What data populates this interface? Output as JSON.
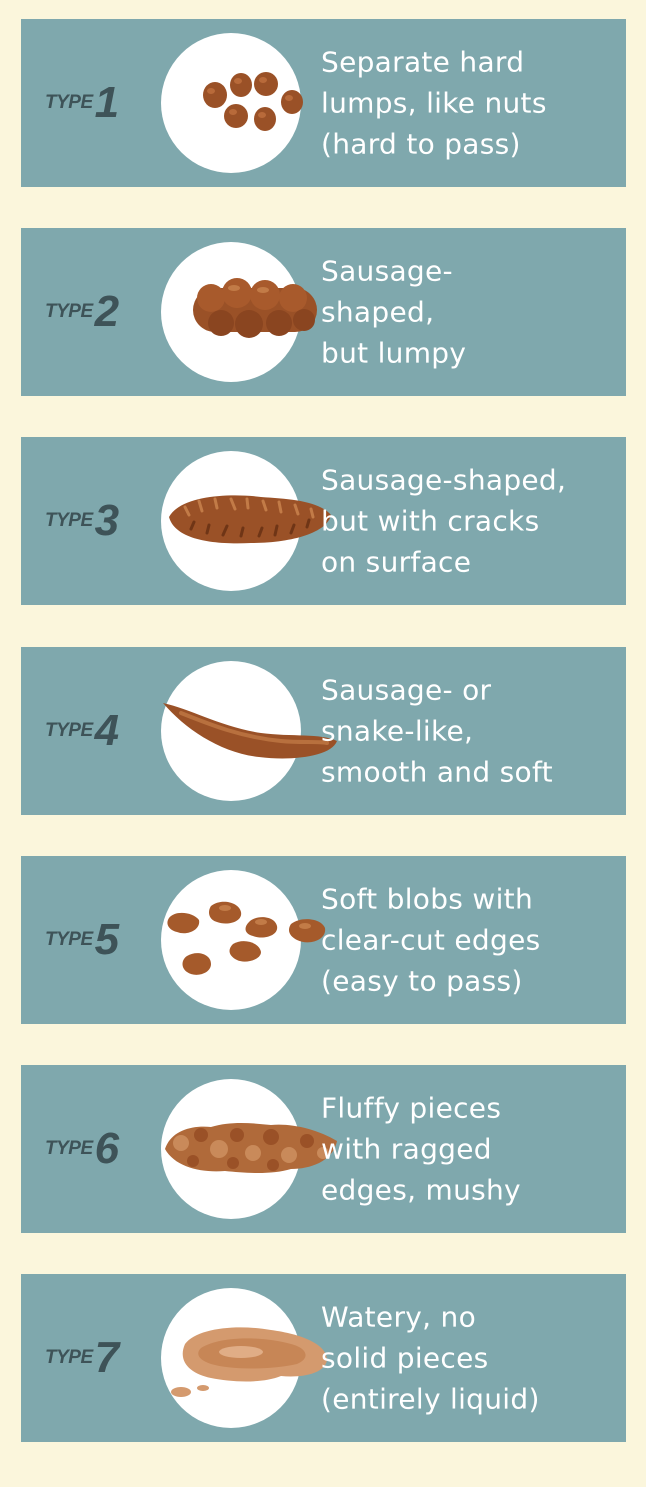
{
  "colors": {
    "background": "#fbf6dc",
    "card": "#7fa8ad",
    "label_text": "#3e5358",
    "description_text": "#ffffff",
    "circle": "#ffffff",
    "stool_dark": "#8a4a22",
    "stool_mid": "#a25a2c",
    "stool_light": "#c07a48",
    "stool_liquid": "#d49a6e"
  },
  "type_word": "TYPE",
  "types": [
    {
      "number": "1",
      "lines": [
        "Separate hard",
        "lumps, like nuts",
        "(hard to pass)"
      ],
      "icon": "hard-lumps-icon"
    },
    {
      "number": "2",
      "lines": [
        "Sausage-",
        "shaped,",
        "but lumpy"
      ],
      "icon": "lumpy-sausage-icon"
    },
    {
      "number": "3",
      "lines": [
        "Sausage-shaped,",
        "but with cracks",
        "on surface"
      ],
      "icon": "cracked-sausage-icon"
    },
    {
      "number": "4",
      "lines": [
        "Sausage- or",
        "snake-like,",
        "smooth and soft"
      ],
      "icon": "smooth-snake-icon"
    },
    {
      "number": "5",
      "lines": [
        "Soft blobs with",
        "clear-cut edges",
        "(easy to pass)"
      ],
      "icon": "soft-blobs-icon"
    },
    {
      "number": "6",
      "lines": [
        "Fluffy pieces",
        "with ragged",
        "edges, mushy"
      ],
      "icon": "fluffy-pieces-icon"
    },
    {
      "number": "7",
      "lines": [
        "Watery, no",
        "solid pieces",
        "(entirely liquid)"
      ],
      "icon": "watery-liquid-icon"
    }
  ]
}
